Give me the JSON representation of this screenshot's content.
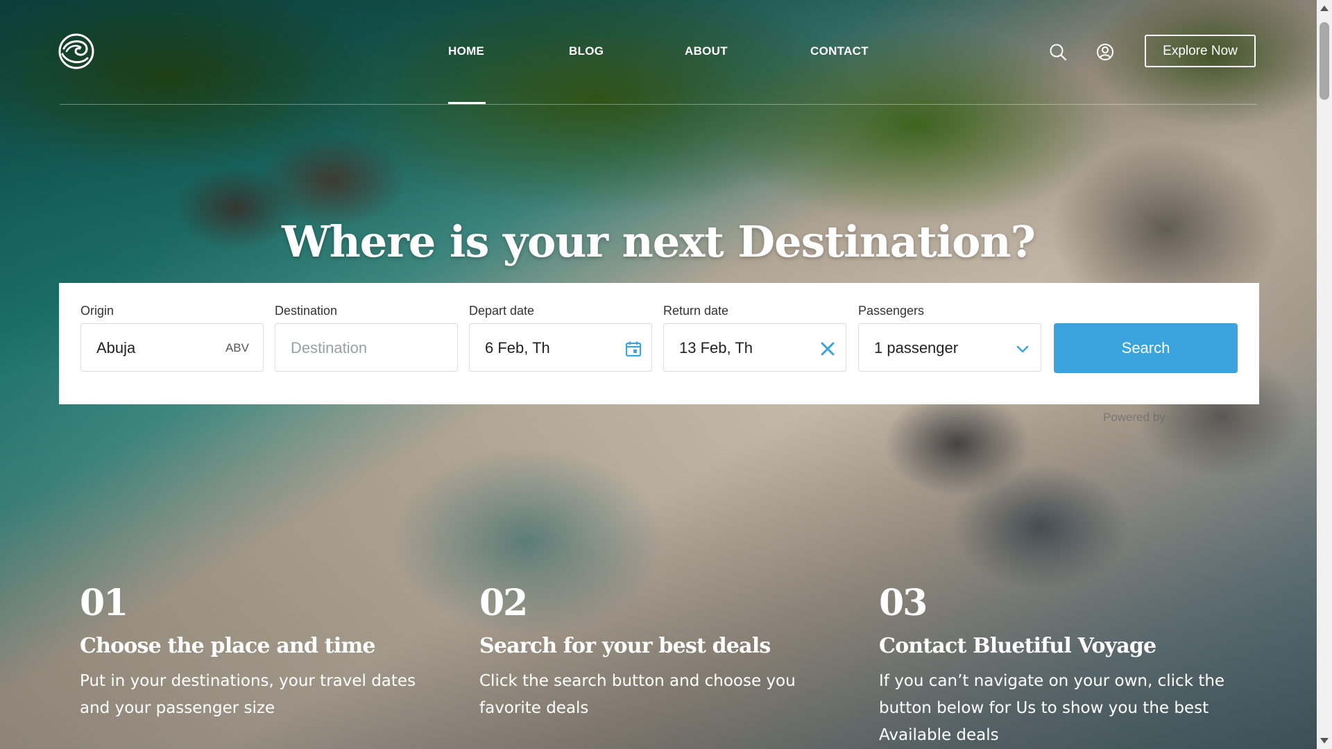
{
  "nav": {
    "items": [
      {
        "label": "HOME",
        "active": true
      },
      {
        "label": "BLOG",
        "active": false
      },
      {
        "label": "ABOUT",
        "active": false
      },
      {
        "label": "CONTACT",
        "active": false
      }
    ],
    "icons": {
      "logo": "wave-logo-icon",
      "search": "search-icon",
      "account": "user-circle-icon"
    },
    "cta_label": "Explore Now"
  },
  "hero": {
    "title": "Where is your next Destination?"
  },
  "search_form": {
    "origin": {
      "label": "Origin",
      "value": "Abuja",
      "code": "ABV"
    },
    "destination": {
      "label": "Destination",
      "placeholder": "Destination"
    },
    "depart": {
      "label": "Depart date",
      "value": "6 Feb, Th",
      "icon": "calendar-icon"
    },
    "return": {
      "label": "Return date",
      "value": "13 Feb, Th",
      "icon": "clear-x-icon"
    },
    "passengers": {
      "label": "Passengers",
      "value": "1 passenger",
      "icon": "chevron-down-icon"
    },
    "search_label": "Search",
    "powered_by": "Powered by",
    "accent_color": "#3ba3dd"
  },
  "steps": [
    {
      "number": "01",
      "title": "Choose the place and time",
      "text": "Put in your destinations, your travel dates and your passenger size"
    },
    {
      "number": "02",
      "title": "Search for your best deals",
      "text": "Click the search button and choose you favorite deals"
    },
    {
      "number": "03",
      "title": "Contact Bluetiful Voyage",
      "text": "If you can’t navigate on your own, click the button below for Us to show you the best Available deals"
    }
  ]
}
